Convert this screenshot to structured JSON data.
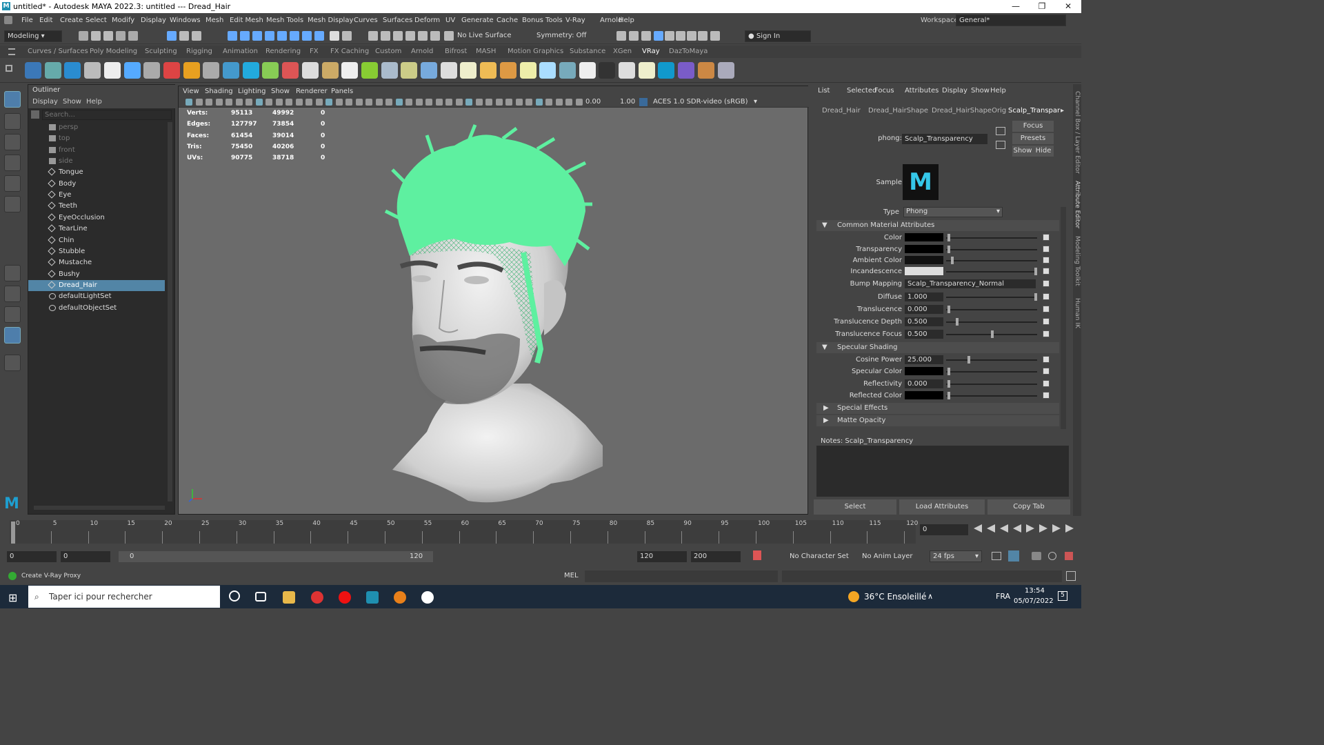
{
  "title": "untitled* - Autodesk MAYA 2022.3: untitled   ---   Dread_Hair",
  "menus": [
    "File",
    "Edit",
    "Create",
    "Select",
    "Modify",
    "Display",
    "Windows",
    "Mesh",
    "Edit Mesh",
    "Mesh Tools",
    "Mesh Display",
    "Curves",
    "Surfaces",
    "Deform",
    "UV",
    "Generate",
    "Cache",
    "Bonus Tools",
    "V-Ray",
    "Arnold",
    "Help"
  ],
  "workspace_label": "Workspace:",
  "workspace_value": "General*",
  "status": {
    "mode": "Modeling",
    "live_surface": "No Live Surface",
    "symmetry": "Symmetry: Off",
    "signin": "Sign In"
  },
  "shelf_tabs": [
    "Curves / Surfaces",
    "Poly Modeling",
    "Sculpting",
    "Rigging",
    "Animation",
    "Rendering",
    "FX",
    "FX Caching",
    "Custom",
    "Arnold",
    "Bifrost",
    "MASH",
    "Motion Graphics",
    "Substance",
    "XGen",
    "VRay",
    "DazToMaya"
  ],
  "shelf_active": "VRay",
  "outliner": {
    "title": "Outliner",
    "menu": [
      "Display",
      "Show",
      "Help"
    ],
    "search_placeholder": "Search...",
    "items": [
      {
        "label": "persp",
        "type": "camera"
      },
      {
        "label": "top",
        "type": "camera"
      },
      {
        "label": "front",
        "type": "camera"
      },
      {
        "label": "side",
        "type": "camera"
      },
      {
        "label": "Tongue",
        "type": "mesh"
      },
      {
        "label": "Body",
        "type": "mesh"
      },
      {
        "label": "Eye",
        "type": "mesh"
      },
      {
        "label": "Teeth",
        "type": "mesh"
      },
      {
        "label": "EyeOcclusion",
        "type": "mesh"
      },
      {
        "label": "TearLine",
        "type": "mesh"
      },
      {
        "label": "Chin",
        "type": "mesh"
      },
      {
        "label": "Stubble",
        "type": "mesh"
      },
      {
        "label": "Mustache",
        "type": "mesh"
      },
      {
        "label": "Bushy",
        "type": "mesh"
      },
      {
        "label": "Dread_Hair",
        "type": "mesh",
        "selected": true
      },
      {
        "label": "defaultLightSet",
        "type": "set"
      },
      {
        "label": "defaultObjectSet",
        "type": "set"
      }
    ]
  },
  "viewport": {
    "menu": [
      "View",
      "Shading",
      "Lighting",
      "Show",
      "Renderer",
      "Panels"
    ],
    "exposure": "0.00",
    "gamma": "1.00",
    "colorspace": "ACES 1.0 SDR-video (sRGB)",
    "hud": [
      {
        "label": "Verts:",
        "a": "95113",
        "b": "49992",
        "c": "0"
      },
      {
        "label": "Edges:",
        "a": "127797",
        "b": "73854",
        "c": "0"
      },
      {
        "label": "Faces:",
        "a": "61454",
        "b": "39014",
        "c": "0"
      },
      {
        "label": "Tris:",
        "a": "75450",
        "b": "40206",
        "c": "0"
      },
      {
        "label": "UVs:",
        "a": "90775",
        "b": "38718",
        "c": "0"
      }
    ]
  },
  "attr": {
    "menu": [
      "List",
      "Selected",
      "Focus",
      "Attributes",
      "Display",
      "Show",
      "Help"
    ],
    "tabs": [
      "Dread_Hair",
      "Dread_HairShape",
      "Dread_HairShapeOrig",
      "Scalp_Transpar"
    ],
    "node_type": "phong:",
    "node_name": "Scalp_Transparency",
    "focus": "Focus",
    "presets": "Presets",
    "show": "Show",
    "hide": "Hide",
    "sample": "Sample",
    "type_label": "Type",
    "type_value": "Phong",
    "sec_common": "Common Material Attributes",
    "color": "Color",
    "transparency": "Transparency",
    "ambient": "Ambient Color",
    "incandescence": "Incandescence",
    "bump": "Bump Mapping",
    "bump_value": "Scalp_Transparency_Normal",
    "diffuse": "Diffuse",
    "diffuse_v": "1.000",
    "translucence": "Translucence",
    "translucence_v": "0.000",
    "tdepth": "Translucence Depth",
    "tdepth_v": "0.500",
    "tfocus": "Translucence Focus",
    "tfocus_v": "0.500",
    "sec_spec": "Specular Shading",
    "cosine": "Cosine Power",
    "cosine_v": "25.000",
    "speccolor": "Specular Color",
    "reflectivity": "Reflectivity",
    "reflectivity_v": "0.000",
    "reflcolor": "Reflected Color",
    "sec_special": "Special Effects",
    "sec_matte": "Matte Opacity",
    "notes": "Notes:  Scalp_Transparency",
    "btn_select": "Select",
    "btn_load": "Load Attributes",
    "btn_copy": "Copy Tab"
  },
  "timeline": {
    "ticks": [
      "0",
      "5",
      "10",
      "15",
      "20",
      "25",
      "30",
      "35",
      "40",
      "45",
      "50",
      "55",
      "60",
      "65",
      "70",
      "75",
      "80",
      "85",
      "90",
      "95",
      "100",
      "105",
      "110",
      "115",
      "120"
    ],
    "current": "0"
  },
  "range": {
    "start": "0",
    "inner_start": "0",
    "slider_start": "0",
    "slider_end": "120",
    "end": "120",
    "outer_end": "200",
    "char_set": "No Character Set",
    "anim_layer": "No Anim Layer",
    "fps": "24 fps"
  },
  "cmd": {
    "status": "Create V-Ray Proxy",
    "lang": "MEL"
  },
  "taskbar": {
    "search": "Taper ici pour rechercher",
    "weather": "36°C  Ensoleillé",
    "lang": "FRA",
    "time": "13:54",
    "date": "05/07/2022",
    "notif": "5"
  },
  "side_tabs": [
    "Channel Box / Layer Editor",
    "Attribute Editor",
    "Modeling Toolkit",
    "Human IK"
  ],
  "colors": {
    "accent": "#5285a6",
    "hair": "#5ef0a0"
  }
}
